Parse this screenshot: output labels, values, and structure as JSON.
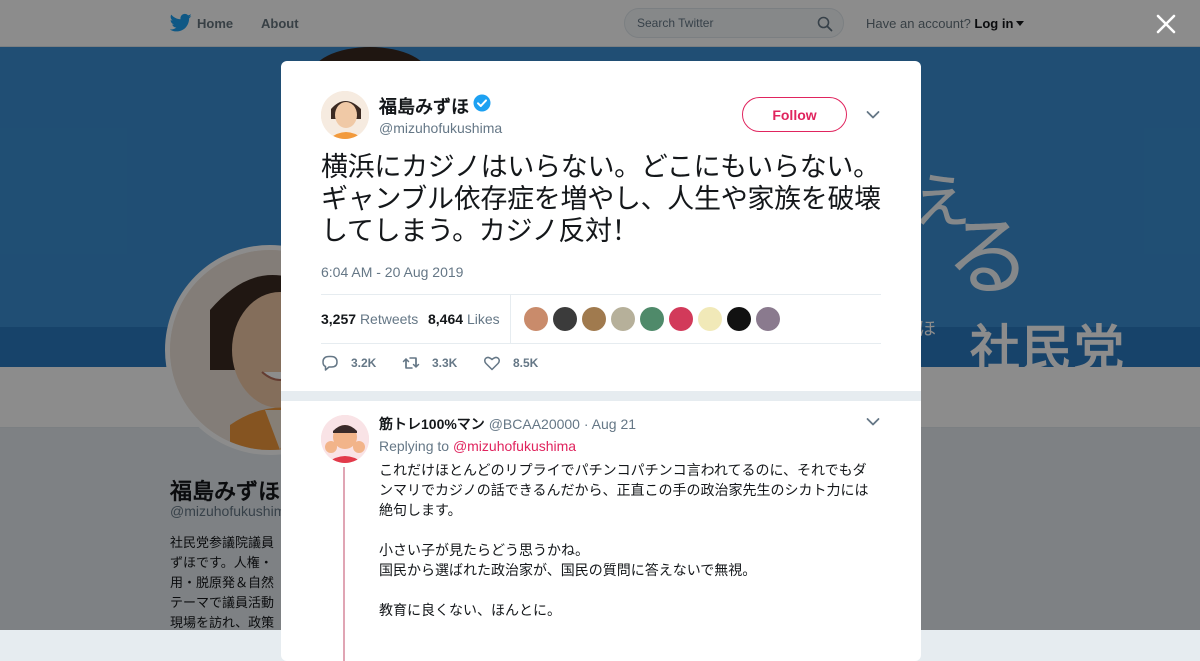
{
  "topbar": {
    "home_label": "Home",
    "about_label": "About",
    "search_placeholder": "Search Twitter",
    "account_prompt": "Have an account?",
    "login_label": "Log in",
    "brand_color": "#1da1f2",
    "icons": [
      "twitter-bird-icon",
      "search-icon",
      "caret-down-icon"
    ]
  },
  "profile_background": {
    "banner_text_line1": "ぇ",
    "banner_text_line2": "る",
    "banner_small_text": "ほ",
    "banner_party_text": "社民党",
    "name": "福島みずほ",
    "handle": "@mizuhofukushima",
    "bio": "社民党参議院議員ずほです。人権・用・脱原発＆自然テーマで議員活動現場を訪れ、政策"
  },
  "modal": {
    "author": {
      "name": "福島みずほ",
      "handle": "@mizuhofukushima",
      "verified": true
    },
    "follow_label": "Follow",
    "tweet_text": "横浜にカジノはいらない。どこにもいらない。ギャンブル依存症を増やし、人生や家族を破壊してしまう。カジノ反対！",
    "timestamp": "6:04 AM - 20 Aug 2019",
    "stats": {
      "retweets_count": "3,257",
      "retweets_label": "Retweets",
      "likes_count": "8,464",
      "likes_label": "Likes"
    },
    "liker_avatar_colors": [
      "#c98b6b",
      "#3b3b3b",
      "#a07a4e",
      "#b6b09a",
      "#4f8a6a",
      "#d23a5a",
      "#f1e9b8",
      "#111111",
      "#8a7a8e"
    ],
    "actions": {
      "replies": "3.2K",
      "retweets": "3.3K",
      "likes": "8.5K"
    },
    "accent_color": "#e0245e"
  },
  "reply": {
    "name": "筋トレ100%マン",
    "handle": "@BCAA20000",
    "date": "Aug 21",
    "replying_to_label": "Replying to",
    "replying_to_handle": "@mizuhofukushima",
    "paragraph1": "これだけほとんどのリプライでパチンコパチンコ言われてるのに、それでもダンマリでカジノの話できるんだから、正直この手の政治家先生のシカト力には絶句します。",
    "paragraph2_line1": "小さい子が見たらどう思うかね。",
    "paragraph2_line2": "国民から選ばれた政治家が、国民の質問に答えないで無視。",
    "paragraph3": "教育に良くない、ほんとに。"
  }
}
